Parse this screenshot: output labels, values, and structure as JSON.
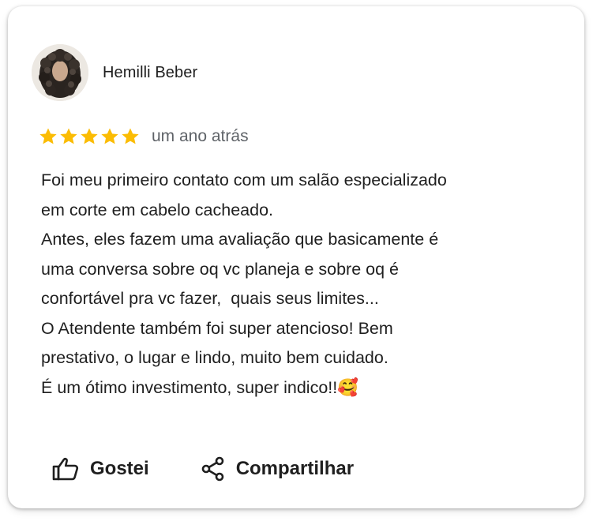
{
  "review": {
    "reviewer_name": "Hemilli Beber",
    "rating": 5,
    "rating_max": 5,
    "star_color": "#fbbc04",
    "time_ago": "um ano atrás",
    "paragraphs": [
      "Foi meu primeiro contato com um salão especializado\nem corte em cabelo cacheado.",
      "Antes, eles fazem uma avaliação que basicamente é\numa conversa sobre oq vc planeja e sobre oq é\nconfortável pra vc fazer,  quais seus limites...",
      "O Atendente também foi super atencioso! Bem\nprestativo, o lugar e lindo, muito bem cuidado.\nÉ um ótimo investimento, super indico!!🥰"
    ]
  },
  "actions": {
    "like_label": "Gostei",
    "share_label": "Compartilhar"
  },
  "icons": {
    "avatar": "profile-photo",
    "star": "star-icon",
    "like": "thumbs-up-icon",
    "share": "share-icon"
  }
}
